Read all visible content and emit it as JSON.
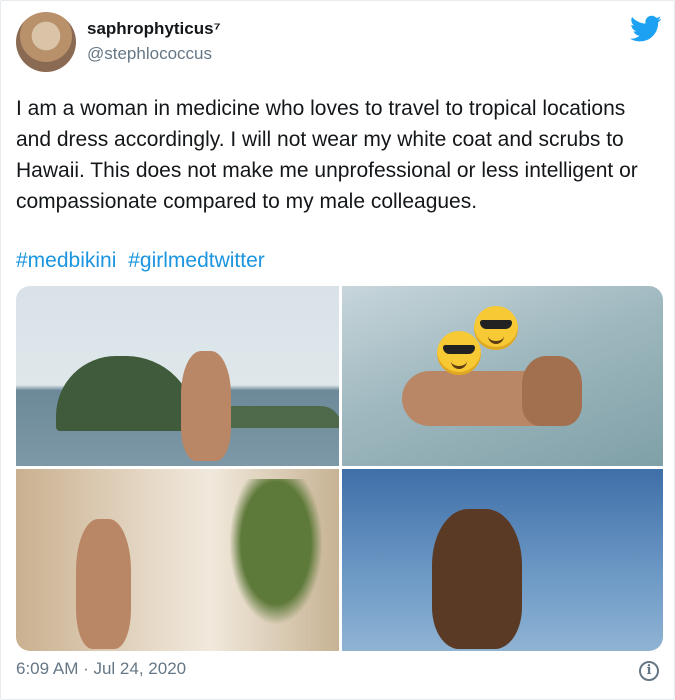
{
  "tweet": {
    "author": {
      "display_name": "saphrophyticus⁷",
      "handle": "@stephlococcus"
    },
    "text": "I am a woman in medicine who loves to travel to tropical locations and dress accordingly. I will not wear my white coat and scrubs to Hawaii. This does not make me unprofessional or less intelligent or compassionate compared to my male colleagues.",
    "hashtags": [
      "#medbikini",
      "#girlmedtwitter"
    ],
    "timestamp": "6:09 AM · Jul 24, 2020",
    "info_icon": "i"
  },
  "icons": {
    "brand": "twitter-bird-icon",
    "info": "info-icon"
  },
  "colors": {
    "link": "#1b95e0",
    "brand": "#1da1f2",
    "secondary_text": "#657786"
  }
}
